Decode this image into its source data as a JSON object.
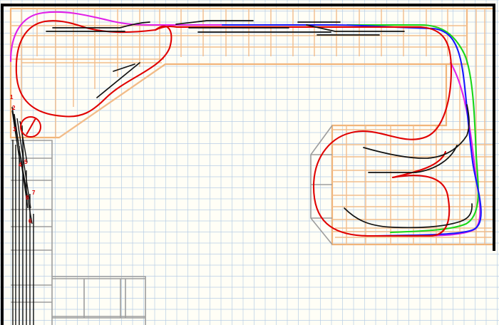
{
  "diagram": {
    "type": "model-railroad-track-plan",
    "colors": {
      "background": "#fffef6",
      "grid": "#b7cde6",
      "benchwork": "#f2bd8c",
      "walls": "#000000",
      "main_red": "#e00000",
      "track_magenta": "#e020e8",
      "track_blue": "#1717ff",
      "track_green": "#19d619",
      "spurs_black": "#111111",
      "structures_gray": "#9d9d9d"
    },
    "turnout_markers": [
      {
        "label": "1"
      },
      {
        "label": "2"
      },
      {
        "label": "3"
      },
      {
        "label": "4"
      },
      {
        "label": "5"
      },
      {
        "label": "7"
      },
      {
        "label": "8"
      },
      {
        "label": "6"
      }
    ]
  }
}
